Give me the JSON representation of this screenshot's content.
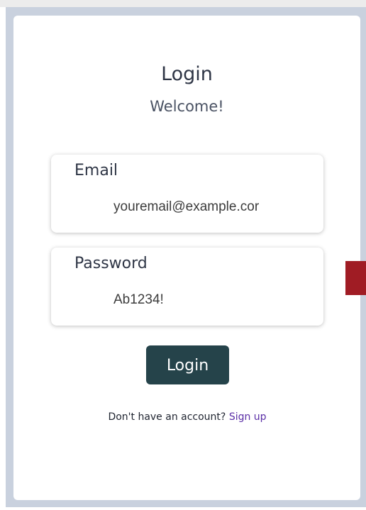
{
  "login": {
    "title": "Login",
    "subtitle": "Welcome!",
    "email": {
      "label": "Email",
      "value": "youremail@example.cor"
    },
    "password": {
      "label": "Password",
      "value": "Ab1234!"
    },
    "submit_label": "Login",
    "signup_prompt": "Don't have an account?",
    "signup_link": "Sign up"
  },
  "colors": {
    "button_bg": "#25434a",
    "link": "#5a2ea6",
    "accent_block": "#a01c24",
    "frame": "#c9d1de"
  }
}
